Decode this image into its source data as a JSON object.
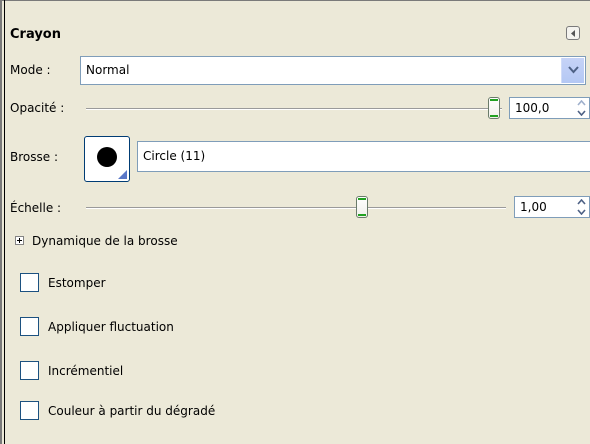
{
  "panel": {
    "title": "Crayon",
    "menu_icon": "tab-menu-icon"
  },
  "mode": {
    "label": "Mode :",
    "value": "Normal"
  },
  "opacity": {
    "label": "Opacité :",
    "value": "100,0",
    "level": 1.0
  },
  "brush": {
    "label": "Brosse :",
    "value": "Circle (11)"
  },
  "scale": {
    "label": "Échelle :",
    "value": "1,00",
    "level": 0.65
  },
  "dynamics": {
    "label": "Dynamique de la brosse"
  },
  "options": [
    {
      "label": "Estomper",
      "checked": false
    },
    {
      "label": "Appliquer fluctuation",
      "checked": false
    },
    {
      "label": "Incrémentiel",
      "checked": false
    },
    {
      "label": "Couleur à partir du dégradé",
      "checked": false
    }
  ],
  "colors": {
    "accent": "#21a121",
    "border": "#7f9db9",
    "background": "#ece9d8"
  }
}
